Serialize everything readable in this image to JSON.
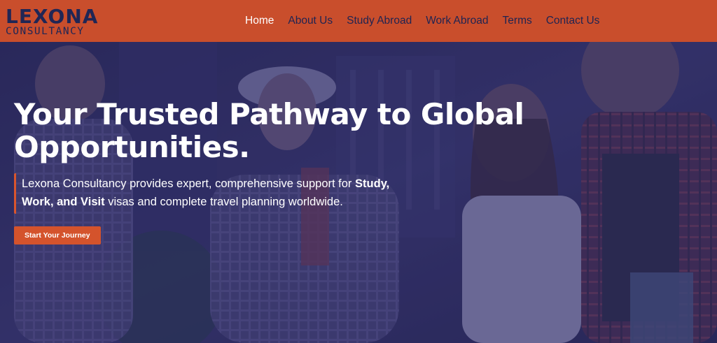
{
  "brand": {
    "name": "LEXONA",
    "tagline": "CONSULTANCY",
    "colors": {
      "header": "#c94e2c",
      "navy": "#202655",
      "accent": "#d4532c",
      "overlay": "#2b2a5e"
    }
  },
  "nav": {
    "items": [
      {
        "label": "Home",
        "active": true
      },
      {
        "label": "About Us",
        "active": false
      },
      {
        "label": "Study Abroad",
        "active": false
      },
      {
        "label": "Work Abroad",
        "active": false
      },
      {
        "label": "Terms",
        "active": false
      },
      {
        "label": "Contact Us",
        "active": false
      }
    ]
  },
  "hero": {
    "title_line1": "Your Trusted Pathway to Global",
    "title_line2": "Opportunities.",
    "desc_part1": "Lexona Consultancy provides expert, comprehensive support for",
    "desc_bold": "Study, Work, and Visit",
    "desc_part2": "visas and complete travel planning worldwide.",
    "cta_label": "Start Your Journey",
    "background": "photo-of-smiling-travelers"
  }
}
